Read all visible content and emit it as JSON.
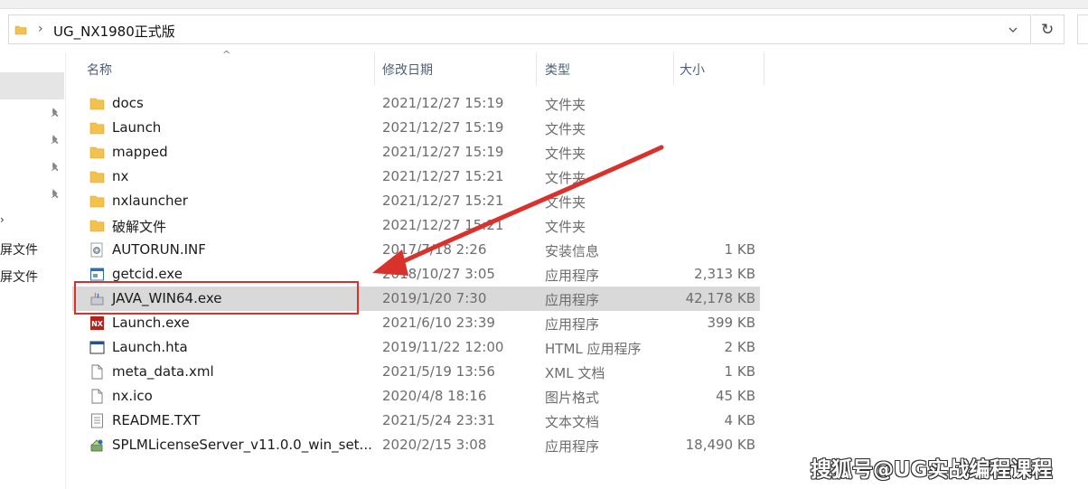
{
  "address": {
    "path": "UG_NX1980正式版",
    "separator": "›"
  },
  "nav": {
    "partial_items": [
      "屏文件",
      "屏文件"
    ]
  },
  "columns": {
    "name": "名称",
    "date": "修改日期",
    "type": "类型",
    "size": "大小"
  },
  "files": [
    {
      "name": "docs",
      "date": "2021/12/27 15:19",
      "type": "文件夹",
      "size": "",
      "icon": "folder-icon"
    },
    {
      "name": "Launch",
      "date": "2021/12/27 15:19",
      "type": "文件夹",
      "size": "",
      "icon": "folder-icon"
    },
    {
      "name": "mapped",
      "date": "2021/12/27 15:19",
      "type": "文件夹",
      "size": "",
      "icon": "folder-icon"
    },
    {
      "name": "nx",
      "date": "2021/12/27 15:21",
      "type": "文件夹",
      "size": "",
      "icon": "folder-icon"
    },
    {
      "name": "nxlauncher",
      "date": "2021/12/27 15:21",
      "type": "文件夹",
      "size": "",
      "icon": "folder-icon"
    },
    {
      "name": "破解文件",
      "date": "2021/12/27 15:21",
      "type": "文件夹",
      "size": "",
      "icon": "folder-icon"
    },
    {
      "name": "AUTORUN.INF",
      "date": "2017/7/18 2:26",
      "type": "安装信息",
      "size": "1 KB",
      "icon": "setup-info-icon"
    },
    {
      "name": "getcid.exe",
      "date": "2018/10/27 3:05",
      "type": "应用程序",
      "size": "2,313 KB",
      "icon": "app-window-icon"
    },
    {
      "name": "JAVA_WIN64.exe",
      "date": "2019/1/20 7:30",
      "type": "应用程序",
      "size": "42,178 KB",
      "icon": "java-installer-icon",
      "selected": true
    },
    {
      "name": "Launch.exe",
      "date": "2021/6/10 23:39",
      "type": "应用程序",
      "size": "399 KB",
      "icon": "nx-logo-icon"
    },
    {
      "name": "Launch.hta",
      "date": "2019/11/22 12:00",
      "type": "HTML 应用程序",
      "size": "2 KB",
      "icon": "hta-window-icon"
    },
    {
      "name": "meta_data.xml",
      "date": "2021/5/19 13:56",
      "type": "XML 文档",
      "size": "1 KB",
      "icon": "document-icon"
    },
    {
      "name": "nx.ico",
      "date": "2020/4/8 18:16",
      "type": "图片格式",
      "size": "45 KB",
      "icon": "document-icon"
    },
    {
      "name": "README.TXT",
      "date": "2021/5/24 23:31",
      "type": "文本文档",
      "size": "4 KB",
      "icon": "text-document-icon"
    },
    {
      "name": "SPLMLicenseServer_v11.0.0_win_set...",
      "date": "2020/2/15 3:08",
      "type": "应用程序",
      "size": "18,490 KB",
      "icon": "installer-package-icon"
    }
  ],
  "annotation": {
    "highlight_color": "#d9312b",
    "arrow_color": "#d9312b"
  },
  "watermark": "搜狐号@UG实战编程课程",
  "colors": {
    "folder": "#f2c14e",
    "selection": "#d9d9d9",
    "header_text": "#4c607a"
  }
}
